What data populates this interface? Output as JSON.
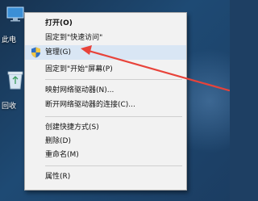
{
  "desktop": {
    "icons": [
      {
        "label": "此电"
      },
      {
        "label": "回收"
      }
    ]
  },
  "context_menu": {
    "items": [
      {
        "label": "打开(O)",
        "bold": true
      },
      {
        "label": "固定到\"快速访问\""
      },
      {
        "label": "管理(G)",
        "highlighted": true,
        "icon": "admin-shield-icon"
      },
      {
        "label": "固定到\"开始\"屏幕(P)"
      },
      {
        "label": "映射网络驱动器(N)..."
      },
      {
        "label": "断开网络驱动器的连接(C)..."
      },
      {
        "label": "创建快捷方式(S)"
      },
      {
        "label": "删除(D)"
      },
      {
        "label": "重命名(M)"
      },
      {
        "label": "属性(R)"
      }
    ]
  },
  "annotation": {
    "color": "#e8433a",
    "icon": "red-arrow-icon"
  }
}
